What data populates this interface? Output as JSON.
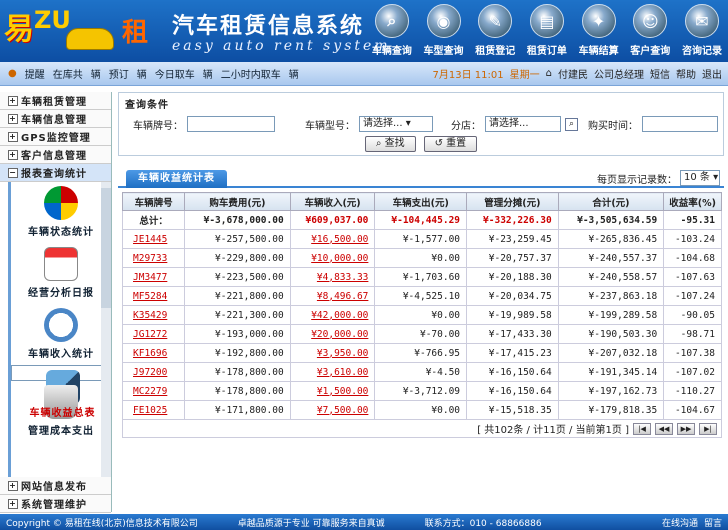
{
  "app": {
    "logo_text": "易",
    "logo_zu": "ZU",
    "logo_zu2": "租",
    "title_cn": "汽车租赁信息系统",
    "title_en": "easy auto rent system"
  },
  "topnav": [
    {
      "label": "车辆查询",
      "icon": "magnifier-icon"
    },
    {
      "label": "车型查询",
      "icon": "car-badge-icon"
    },
    {
      "label": "租赁登记",
      "icon": "pen-icon"
    },
    {
      "label": "租赁订单",
      "icon": "order-icon"
    },
    {
      "label": "车辆结算",
      "icon": "settle-icon"
    },
    {
      "label": "客户查询",
      "icon": "customer-icon"
    },
    {
      "label": "咨询记录",
      "icon": "record-icon"
    }
  ],
  "infobar": {
    "items": [
      "提醒",
      "在库共",
      "辆",
      "预订",
      "辆",
      "今日取车",
      "辆",
      "二小时内取车",
      "辆"
    ],
    "date": "7月13日  11:01",
    "weekday": "星期一",
    "user": "付建民",
    "role": "公司总经理",
    "sms": "短信",
    "help": "帮助",
    "logout": "退出"
  },
  "sidebar": {
    "top": [
      "车辆租赁管理",
      "车辆信息管理",
      "GPS监控管理",
      "客户信息管理",
      "报表查询统计"
    ],
    "modules": [
      {
        "label": "车辆状态统计"
      },
      {
        "label": "经营分析日报"
      },
      {
        "label": "车辆收入统计"
      },
      {
        "label": "车辆收益总表"
      },
      {
        "label": "管理成本支出"
      }
    ],
    "bottom": [
      "网站信息发布",
      "系统管理维护"
    ]
  },
  "query": {
    "title": "查询条件",
    "plate_label": "车辆牌号：",
    "type_label": "车辆型号：",
    "type_value": "请选择...",
    "branch_label": "分店：",
    "branch_value": "请选择...",
    "buy_time_label": "购买时间：",
    "search_btn": "查找",
    "reset_btn": "重置"
  },
  "tab": {
    "label": "车辆收益统计表",
    "pagesize_label": "每页显示记录数：",
    "pagesize_value": "10 条"
  },
  "table": {
    "headers": [
      "车辆牌号",
      "购车费用(元)",
      "车辆收入(元)",
      "车辆支出(元)",
      "管理分摊(元)",
      "合计(元)",
      "收益率(%)"
    ],
    "total": [
      "总计：",
      "¥-3,678,000.00",
      "¥609,037.00",
      "¥-104,445.29",
      "¥-332,226.30",
      "¥-3,505,634.59",
      "-95.31"
    ],
    "rows": [
      [
        "JE1445",
        "¥-257,500.00",
        "¥16,500.00",
        "¥-1,577.00",
        "¥-23,259.45",
        "¥-265,836.45",
        "-103.24"
      ],
      [
        "M29733",
        "¥-229,800.00",
        "¥10,000.00",
        "¥0.00",
        "¥-20,757.37",
        "¥-240,557.37",
        "-104.68"
      ],
      [
        "JM3477",
        "¥-223,500.00",
        "¥4,833.33",
        "¥-1,703.60",
        "¥-20,188.30",
        "¥-240,558.57",
        "-107.63"
      ],
      [
        "MF5284",
        "¥-221,800.00",
        "¥8,496.67",
        "¥-4,525.10",
        "¥-20,034.75",
        "¥-237,863.18",
        "-107.24"
      ],
      [
        "K35429",
        "¥-221,300.00",
        "¥42,000.00",
        "¥0.00",
        "¥-19,989.58",
        "¥-199,289.58",
        "-90.05"
      ],
      [
        "JG1272",
        "¥-193,000.00",
        "¥20,000.00",
        "¥-70.00",
        "¥-17,433.30",
        "¥-190,503.30",
        "-98.71"
      ],
      [
        "KF1696",
        "¥-192,800.00",
        "¥3,950.00",
        "¥-766.95",
        "¥-17,415.23",
        "¥-207,032.18",
        "-107.38"
      ],
      [
        "J97200",
        "¥-178,800.00",
        "¥3,610.00",
        "¥-4.50",
        "¥-16,150.64",
        "¥-191,345.14",
        "-107.02"
      ],
      [
        "MC2279",
        "¥-178,800.00",
        "¥1,500.00",
        "¥-3,712.09",
        "¥-16,150.64",
        "¥-197,162.73",
        "-110.27"
      ],
      [
        "FE1025",
        "¥-171,800.00",
        "¥7,500.00",
        "¥0.00",
        "¥-15,518.35",
        "¥-179,818.35",
        "-104.67"
      ]
    ]
  },
  "pager": {
    "text": "[ 共102条 / 计11页 / 当前第1页 ]"
  },
  "footer": {
    "copyright": "Copyright © 易租在线(北京)信息技术有限公司",
    "slogan": "卓越品质源于专业    可靠服务来自真诚",
    "phone": "联系方式：010 - 68866886",
    "chat": "在线沟通",
    "msg": "留言"
  }
}
